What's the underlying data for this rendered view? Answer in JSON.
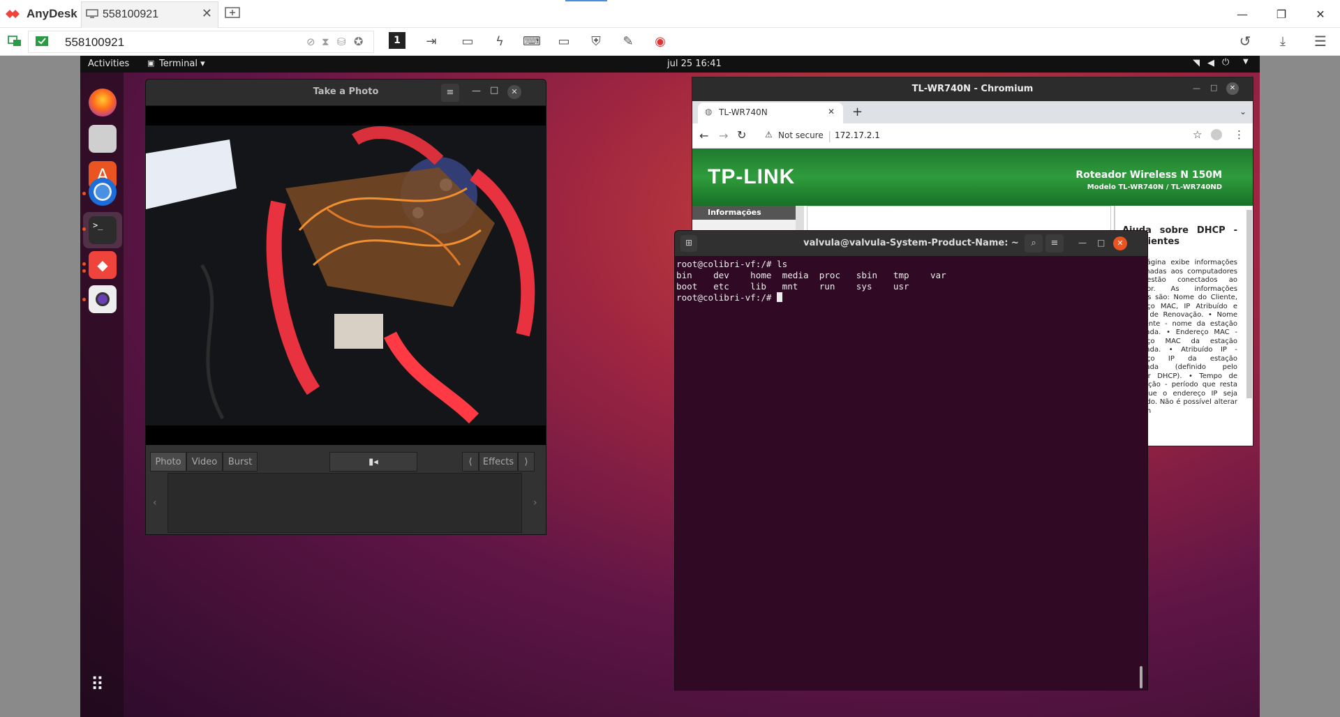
{
  "anydesk": {
    "app_name": "AnyDesk",
    "tab_label": "558100921",
    "address_value": "558100921"
  },
  "topbar": {
    "activities": "Activities",
    "app_menu": "Terminal ▾",
    "clock": "jul 25  16:41"
  },
  "cheese": {
    "title": "Take a Photo",
    "modes": [
      "Photo",
      "Video",
      "Burst"
    ],
    "effects": "Effects"
  },
  "chromium": {
    "window_title": "TL-WR740N - Chromium",
    "tab_title": "TL-WR740N",
    "security": "Not secure",
    "url": "172.17.2.1",
    "brand": "TP-LINK",
    "header_line1": "Roteador Wireless N 150M",
    "header_line2": "Modelo TL-WR740N / TL-WR740ND",
    "menu_item": "Informações",
    "help_title": "Ajuda sobre DHCP - de Clientes",
    "help_text": "Esta página exibe informações relacionadas aos computadores que estão conectados ao Roteador. As informações exibidas são: Nome do Cliente, Endereço MAC, IP Atribuído e Tempo de Renovação. • Nome do Cliente - nome da estação conectada. • Endereço MAC - endereço MAC da estação conectada. • Atribuído IP - endereço IP da estação conectada (definido pelo servidor DHCP). • Tempo de Renovação - período que resta para que o endereço IP seja renovado. Não é possível alterar nenhum"
  },
  "terminal": {
    "title": "valvula@valvula-System-Product-Name: ~",
    "lines": [
      "root@colibri-vf:/# ls",
      "bin    dev    home  media  proc   sbin   tmp    var",
      "boot   etc    lib   mnt    run    sys    usr"
    ],
    "prompt": "root@colibri-vf:/# "
  }
}
